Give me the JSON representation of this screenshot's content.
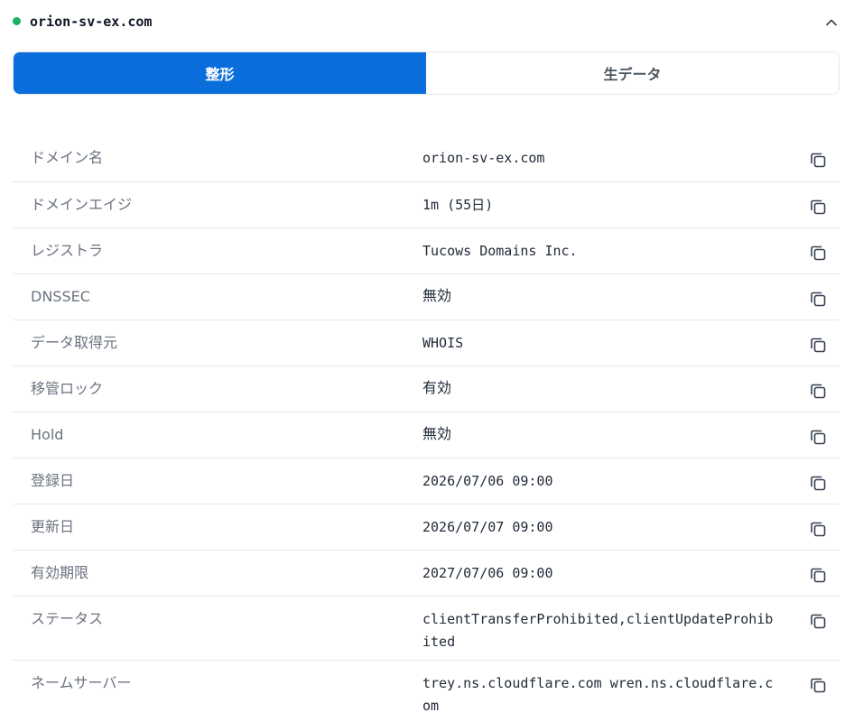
{
  "header": {
    "domain": "orion-sv-ex.com",
    "status_color": "#16b364"
  },
  "tabs": [
    {
      "label": "整形",
      "active": true
    },
    {
      "label": "生データ",
      "active": false
    }
  ],
  "colors": {
    "accent": "#0a6fdc"
  },
  "rows": [
    {
      "label": "ドメイン名",
      "value": "orion-sv-ex.com"
    },
    {
      "label": "ドメインエイジ",
      "value": "1m (55日)"
    },
    {
      "label": "レジストラ",
      "value": "Tucows Domains Inc."
    },
    {
      "label": "DNSSEC",
      "value": "無効"
    },
    {
      "label": "データ取得元",
      "value": "WHOIS"
    },
    {
      "label": "移管ロック",
      "value": "有効"
    },
    {
      "label": "Hold",
      "value": "無効"
    },
    {
      "label": "登録日",
      "value": "2026/07/06 09:00"
    },
    {
      "label": "更新日",
      "value": "2026/07/07 09:00"
    },
    {
      "label": "有効期限",
      "value": "2027/07/06 09:00"
    },
    {
      "label": "ステータス",
      "value": "clientTransferProhibited,clientUpdateProhibited"
    },
    {
      "label": "ネームサーバー",
      "value": "trey.ns.cloudflare.com wren.ns.cloudflare.com"
    }
  ],
  "icons": {
    "copy": "copy-icon",
    "collapse": "chevron-up-icon"
  }
}
